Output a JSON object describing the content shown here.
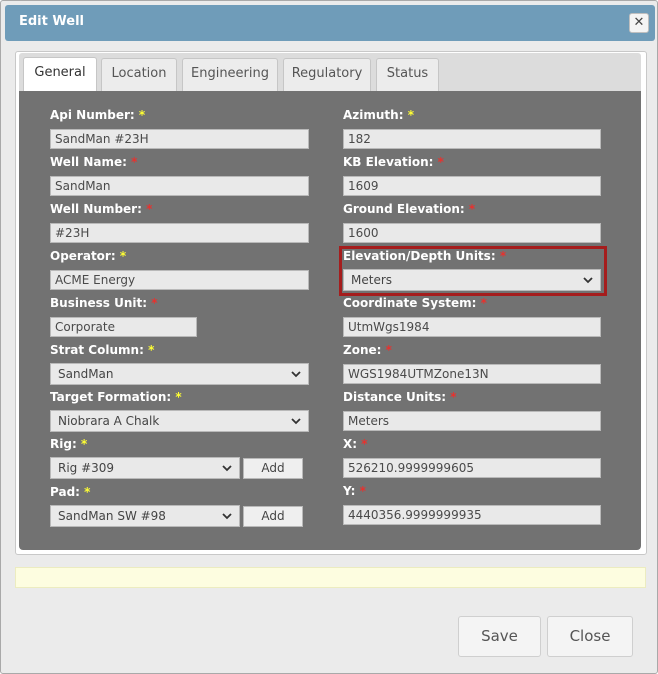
{
  "dialog": {
    "title": "Edit Well",
    "close_glyph": "✕"
  },
  "tabs": [
    {
      "label": "General",
      "active": true
    },
    {
      "label": "Location",
      "active": false
    },
    {
      "label": "Engineering",
      "active": false
    },
    {
      "label": "Regulatory",
      "active": false
    },
    {
      "label": "Status",
      "active": false
    }
  ],
  "required_marker": "*",
  "fields": {
    "api_number": {
      "label": "Api Number:",
      "value": "SandMan #23H"
    },
    "well_name": {
      "label": "Well Name:",
      "value": "SandMan"
    },
    "well_number": {
      "label": "Well Number:",
      "value": "#23H"
    },
    "operator": {
      "label": "Operator:",
      "value": "ACME Energy"
    },
    "business_unit": {
      "label": "Business Unit:",
      "value": "Corporate"
    },
    "strat_column": {
      "label": "Strat Column:",
      "value": "SandMan"
    },
    "target_formation": {
      "label": "Target Formation:",
      "value": "Niobrara A Chalk"
    },
    "rig": {
      "label": "Rig:",
      "value": "Rig #309"
    },
    "pad": {
      "label": "Pad:",
      "value": "SandMan SW #98"
    },
    "azimuth": {
      "label": "Azimuth:",
      "value": "182"
    },
    "kb_elevation": {
      "label": "KB Elevation:",
      "value": "1609"
    },
    "ground_elevation": {
      "label": "Ground Elevation:",
      "value": "1600"
    },
    "elevation_units": {
      "label": "Elevation/Depth Units:",
      "value": "Meters"
    },
    "coordinate_system": {
      "label": "Coordinate System:",
      "value": "UtmWgs1984"
    },
    "zone": {
      "label": "Zone:",
      "value": "WGS1984UTMZone13N"
    },
    "distance_units": {
      "label": "Distance Units:",
      "value": "Meters"
    },
    "x": {
      "label": "X:",
      "value": "526210.9999999605"
    },
    "y": {
      "label": "Y:",
      "value": "4440356.9999999935"
    }
  },
  "buttons": {
    "add": "Add",
    "save": "Save",
    "close": "Close"
  },
  "colors": {
    "titlebar": "#6f9cb9",
    "content_bg": "#727272",
    "required_yellow": "#ffff33",
    "required_red": "#e8312e",
    "highlight_border": "#a51d1d"
  },
  "icons": {
    "dropdown": "chevron-down-icon",
    "close": "close-icon"
  }
}
